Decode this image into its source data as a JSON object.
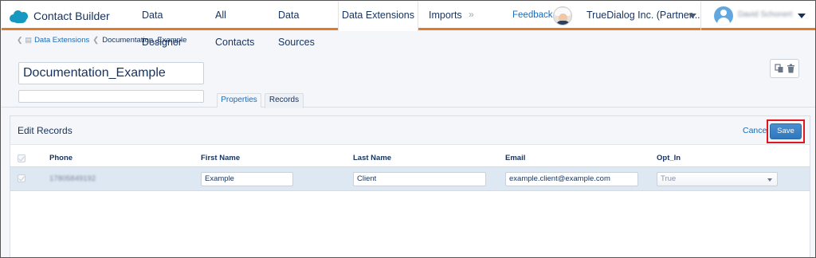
{
  "app": {
    "title": "Contact Builder"
  },
  "nav": {
    "tabs": [
      {
        "label": "Data Designer"
      },
      {
        "label": "All Contacts"
      },
      {
        "label": "Data Sources"
      },
      {
        "label": "Data Extensions"
      },
      {
        "label": "Imports"
      }
    ],
    "overflow_label": "»",
    "feedback_label": "Feedback",
    "org_label": "TrueDialog Inc. (Partner...",
    "user_name": "David Schonert",
    "accent_color": "#e07b2a"
  },
  "breadcrumb": {
    "items": [
      {
        "label": "Data Extensions"
      },
      {
        "label": "Documentation_Example"
      }
    ]
  },
  "extension": {
    "name": "Documentation_Example",
    "description": ""
  },
  "page_tabs": [
    {
      "label": "Properties"
    },
    {
      "label": "Records"
    }
  ],
  "records": {
    "title": "Edit Records",
    "cancel_label": "Cancel",
    "save_label": "Save",
    "columns": [
      "Phone",
      "First Name",
      "Last Name",
      "Email",
      "Opt_In"
    ],
    "rows": [
      {
        "phone": "17805849192",
        "first_name": "Example",
        "last_name": "Client",
        "email": "example.client@example.com",
        "opt_in": "True"
      }
    ]
  }
}
